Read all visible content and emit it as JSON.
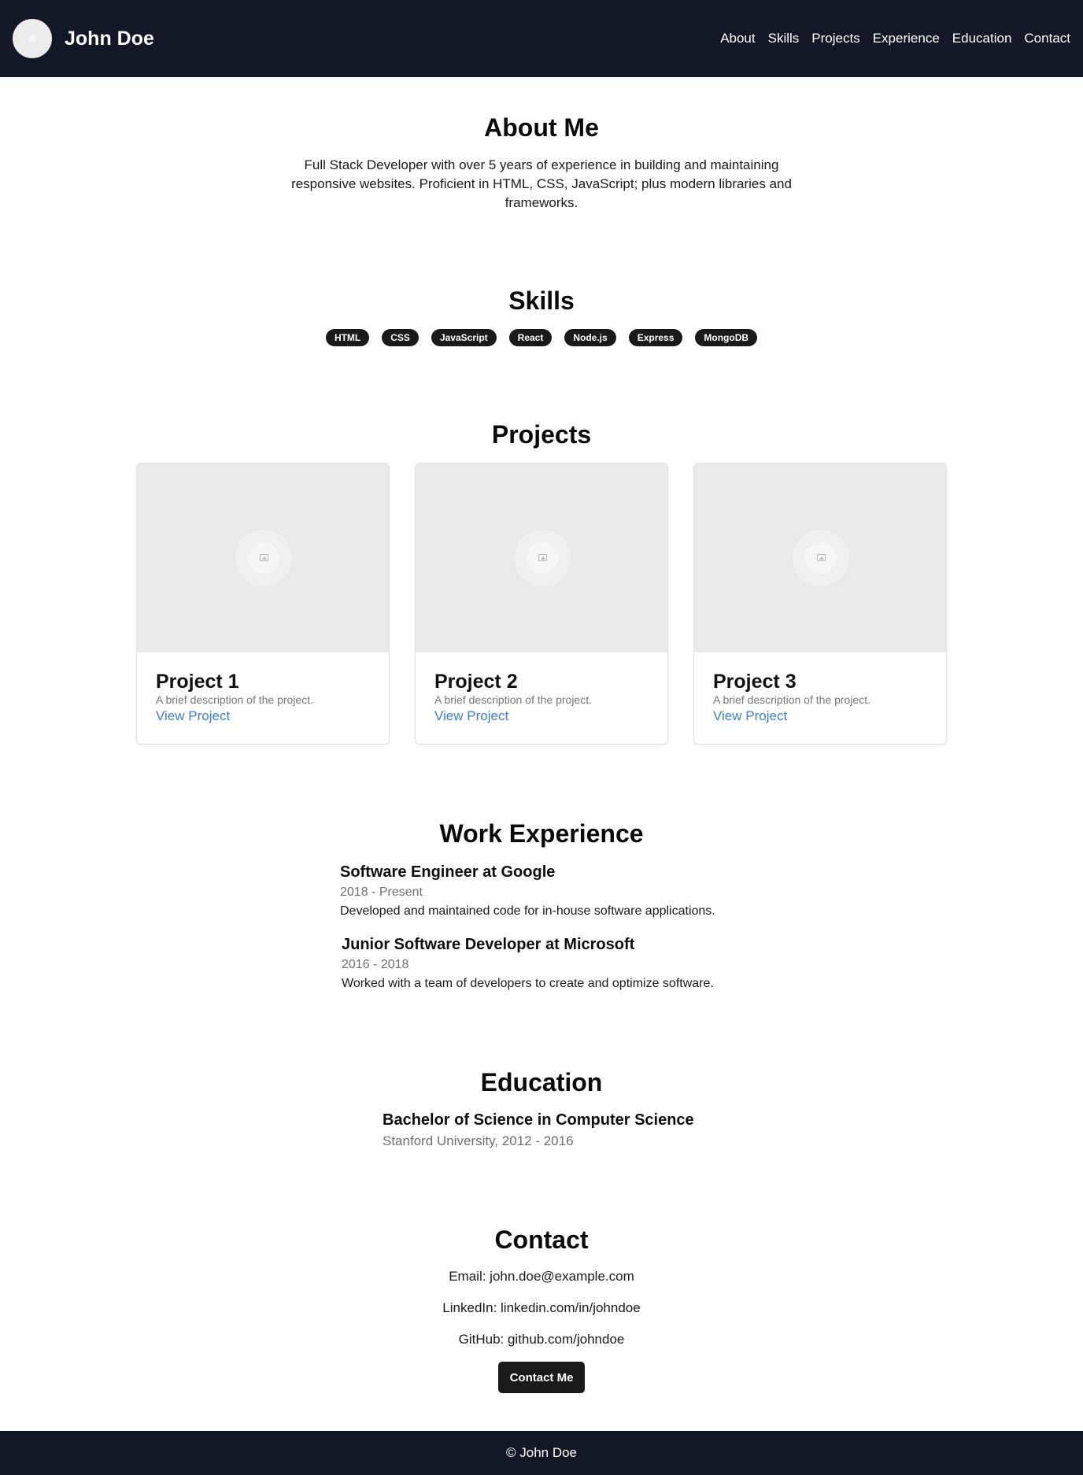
{
  "header": {
    "name": "John Doe",
    "nav": [
      "About",
      "Skills",
      "Projects",
      "Experience",
      "Education",
      "Contact"
    ]
  },
  "about": {
    "title": "About Me",
    "text": "Full Stack Developer with over 5 years of experience in building and maintaining responsive websites. Proficient in HTML, CSS, JavaScript; plus modern libraries and frameworks."
  },
  "skills": {
    "title": "Skills",
    "items": [
      "HTML",
      "CSS",
      "JavaScript",
      "React",
      "Node.js",
      "Express",
      "MongoDB"
    ]
  },
  "projects": {
    "title": "Projects",
    "items": [
      {
        "title": "Project 1",
        "description": "A brief description of the project.",
        "link": "View Project"
      },
      {
        "title": "Project 2",
        "description": "A brief description of the project.",
        "link": "View Project"
      },
      {
        "title": "Project 3",
        "description": "A brief description of the project.",
        "link": "View Project"
      }
    ]
  },
  "experience": {
    "title": "Work Experience",
    "items": [
      {
        "title": "Software Engineer at Google",
        "dates": "2018 - Present",
        "description": "Developed and maintained code for in-house software applications."
      },
      {
        "title": "Junior Software Developer at Microsoft",
        "dates": "2016 - 2018",
        "description": "Worked with a team of developers to create and optimize software."
      }
    ]
  },
  "education": {
    "title": "Education",
    "degree": "Bachelor of Science in Computer Science",
    "school": "Stanford University, 2012 - 2016"
  },
  "contact": {
    "title": "Contact",
    "email": "Email: john.doe@example.com",
    "linkedin": "LinkedIn: linkedin.com/in/johndoe",
    "github": "GitHub: github.com/johndoe",
    "button": "Contact Me"
  },
  "footer": {
    "text": "© John Doe"
  },
  "colors": {
    "header_bg": "#121826",
    "pill_bg": "#1a1a1a",
    "link": "#3d7fd0"
  }
}
